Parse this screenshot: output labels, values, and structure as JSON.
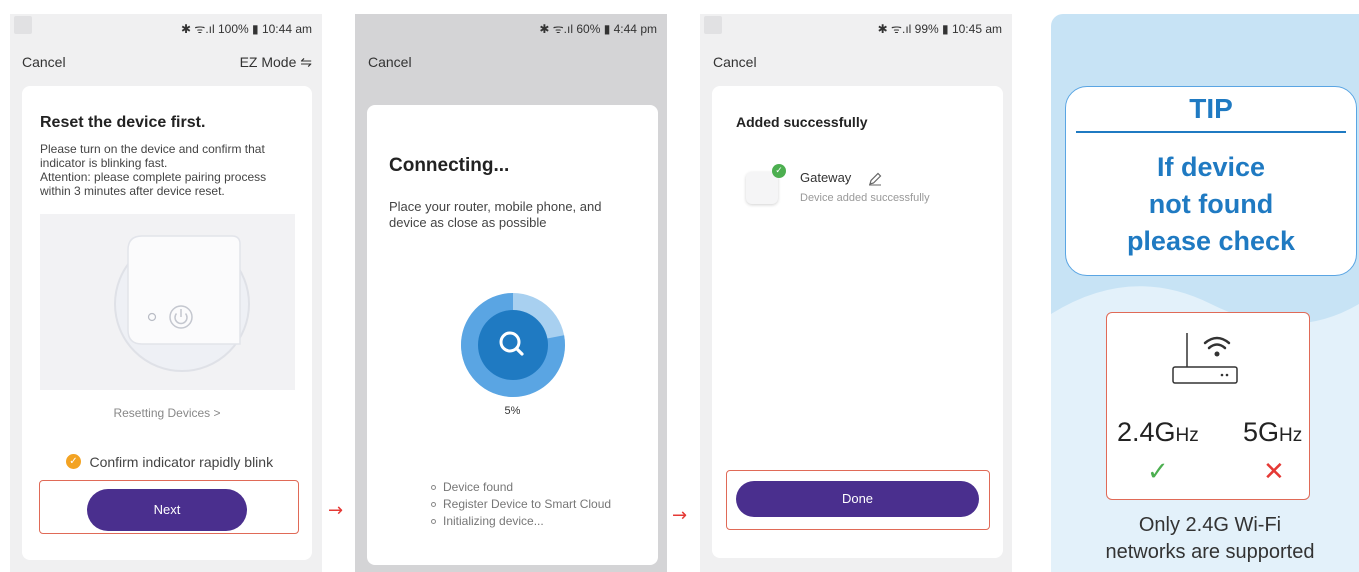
{
  "screen1": {
    "status": "✱ ᯤ.ıl 100% ▮ 10:44 am",
    "cancel": "Cancel",
    "ez_mode": "EZ Mode ⇋",
    "title": "Reset the device first.",
    "instructions": [
      "Please turn on the device and confirm that",
      "indicator is blinking fast.",
      "Attention: please complete pairing process",
      "within 3 minutes after device reset."
    ],
    "resetting_link": "Resetting Devices >",
    "confirm_label": "Confirm indicator rapidly blink",
    "next_button": "Next"
  },
  "screen2": {
    "status": "✱ ᯤ.ıl 60% ▮ 4:44 pm",
    "cancel": "Cancel",
    "title": "Connecting...",
    "description": [
      "Place your router, mobile phone, and",
      "device as close as possible"
    ],
    "progress_percent": "5%",
    "progress_value": 0.05,
    "steps": [
      "Device found",
      "Register Device to Smart Cloud",
      "Initializing device..."
    ]
  },
  "screen3": {
    "status": "✱ ᯤ.ıl 99% ▮ 10:45 am",
    "cancel": "Cancel",
    "title": "Added successfully",
    "device_name": "Gateway",
    "device_status": "Device added successfully",
    "done_button": "Done"
  },
  "tip": {
    "heading": "TIP",
    "message": [
      "If device",
      "not found",
      "please check"
    ],
    "band_24": "2.4G",
    "band_5": "5G",
    "unit": "Hz",
    "footer": [
      "Only 2.4G Wi-Fi",
      "networks are supported"
    ]
  },
  "colors": {
    "accent_purple": "#4a2f8e",
    "tip_blue": "#1f7ac2",
    "success_green": "#4caf50",
    "error_red": "#e53935",
    "highlight_border": "#e06a57"
  },
  "icons": {
    "arrow": "→"
  }
}
